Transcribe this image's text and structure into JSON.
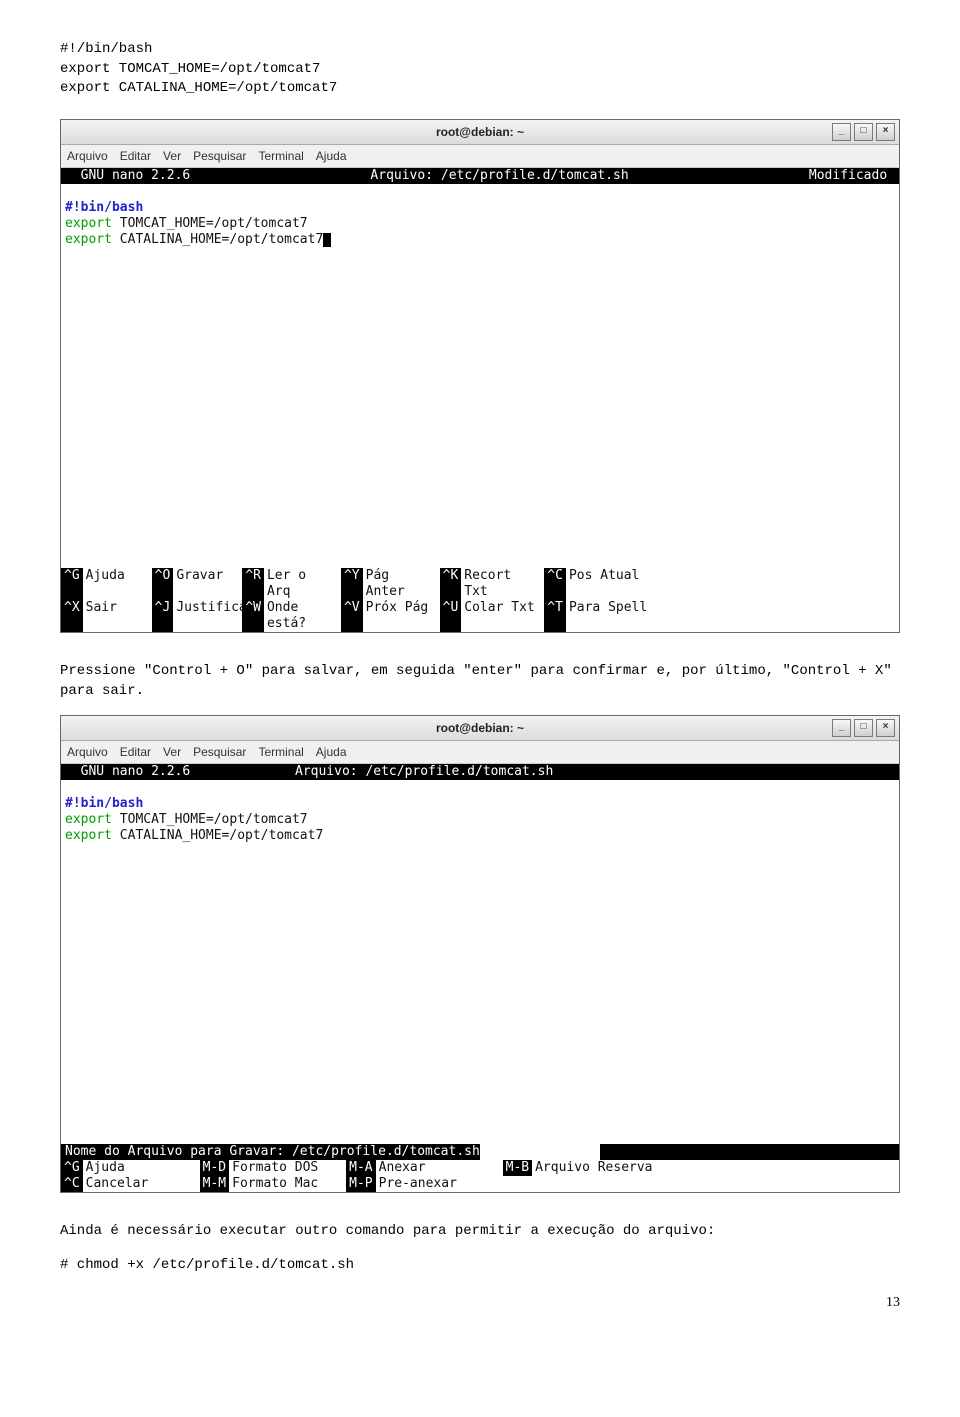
{
  "code_top": "#!/bin/bash\nexport TOMCAT_HOME=/opt/tomcat7\nexport CATALINA_HOME=/opt/tomcat7",
  "para1": "Pressione \"Control + O\" para salvar, em seguida \"enter\" para confirmar e, por último, \"Control + X\" para sair.",
  "para2": "Ainda é necessário executar outro comando para permitir a execução do arquivo:",
  "cmd_bottom": "# chmod +x /etc/profile.d/tomcat.sh",
  "window_title": "root@debian: ~",
  "menu": {
    "file": "Arquivo",
    "edit": "Editar",
    "view": "Ver",
    "search": "Pesquisar",
    "terminal": "Terminal",
    "help": "Ajuda"
  },
  "win_btns": {
    "min": "_",
    "max": "□",
    "close": "×"
  },
  "nano1": {
    "header_left": "  GNU nano 2.2.6",
    "header_mid": "Arquivo: /etc/profile.d/tomcat.sh",
    "header_right": "Modificado ",
    "l1": "#!bin/bash",
    "l2a": "export",
    "l2b": " TOMCAT_HOME=/opt/tomcat7",
    "l3a": "export",
    "l3b": " CATALINA_HOME=/opt/tomcat7",
    "sc": {
      "g": "^G",
      "gtxt": "Ajuda",
      "o": "^O",
      "otxt": "Gravar",
      "r": "^R",
      "rtxt": "Ler o Arq",
      "y": "^Y",
      "ytxt": "Pág Anter",
      "k": "^K",
      "ktxt": "Recort Txt",
      "c": "^C",
      "ctxt": "Pos Atual",
      "x": "^X",
      "xtxt": "Sair",
      "j": "^J",
      "jtxt": "Justificar",
      "w": "^W",
      "wtxt": "Onde está?",
      "v": "^V",
      "vtxt": "Próx Pág",
      "u": "^U",
      "utxt": "Colar Txt",
      "t": "^T",
      "ttxt": "Para Spell"
    }
  },
  "nano2": {
    "header_left": "  GNU nano 2.2.6",
    "header_mid": "Arquivo: /etc/profile.d/tomcat.sh",
    "l1": "#!bin/bash",
    "l2a": "export",
    "l2b": " TOMCAT_HOME=/opt/tomcat7",
    "l3a": "export",
    "l3b": " CATALINA_HOME=/opt/tomcat7",
    "prompt": "Nome do Arquivo para Gravar: /etc/profile.d/tomcat.sh",
    "sc": {
      "g": "^G",
      "gtxt": "Ajuda",
      "md": "M-D",
      "mdtxt": "Formato DOS",
      "ma": "M-A",
      "matxt": "Anexar",
      "mb": "M-B",
      "mbtxt": "Arquivo Reserva",
      "c": "^C",
      "ctxt": "Cancelar",
      "mm": "M-M",
      "mmtxt": "Formato Mac",
      "mp": "M-P",
      "mptxt": "Pre-anexar"
    }
  },
  "page_number": "13"
}
